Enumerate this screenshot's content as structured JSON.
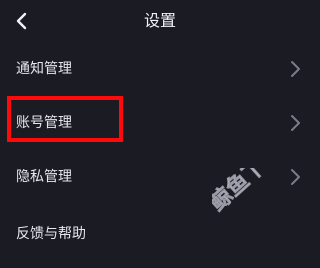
{
  "header": {
    "title": "设置"
  },
  "menu": [
    {
      "label": "通知管理",
      "has_chevron": true
    },
    {
      "label": "账号管理",
      "has_chevron": true
    },
    {
      "label": "隐私管理",
      "has_chevron": true
    },
    {
      "label": "反馈与帮助",
      "has_chevron": false
    }
  ],
  "watermark": {
    "text": "鲸鱼下载"
  },
  "colors": {
    "background": "#1b1b24",
    "text": "#e6e6ec",
    "chevron": "#7c7c88",
    "highlight": "#ff0a0a"
  },
  "icons": {
    "back": "chevron-left-icon",
    "row_arrow": "chevron-right-icon"
  }
}
